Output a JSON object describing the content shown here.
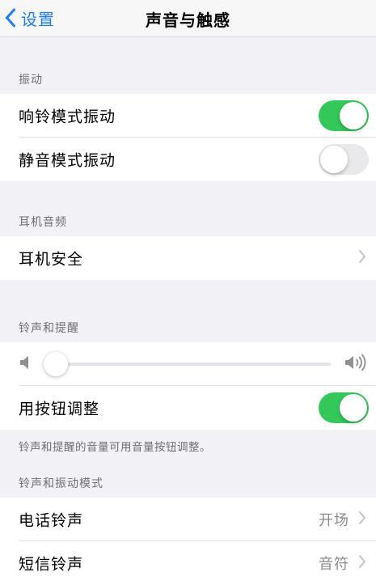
{
  "nav": {
    "back_label": "设置",
    "title": "声音与触感"
  },
  "vibration": {
    "header": "振动",
    "ring_vibrate": {
      "label": "响铃模式振动",
      "on": true
    },
    "silent_vibrate": {
      "label": "静音模式振动",
      "on": false
    }
  },
  "headphone": {
    "header": "耳机音频",
    "safety_label": "耳机安全"
  },
  "ringer": {
    "header": "铃声和提醒",
    "volume_level": 0.03,
    "change_with_buttons": {
      "label": "用按钮调整",
      "on": true
    },
    "footer": "铃声和提醒的音量可用音量按钮调整。"
  },
  "patterns": {
    "header": "铃声和振动模式",
    "items": [
      {
        "label": "电话铃声",
        "value": "开场"
      },
      {
        "label": "短信铃声",
        "value": "音符"
      }
    ]
  },
  "colors": {
    "accent": "#1f7cf5",
    "toggle_on": "#34c759",
    "toggle_off": "#e9e9eb",
    "background": "#f2f2f6"
  },
  "icons": {
    "back": "chevron-left-icon",
    "disclosure": "chevron-right-icon",
    "volume_low": "speaker-low-icon",
    "volume_high": "speaker-high-icon"
  }
}
